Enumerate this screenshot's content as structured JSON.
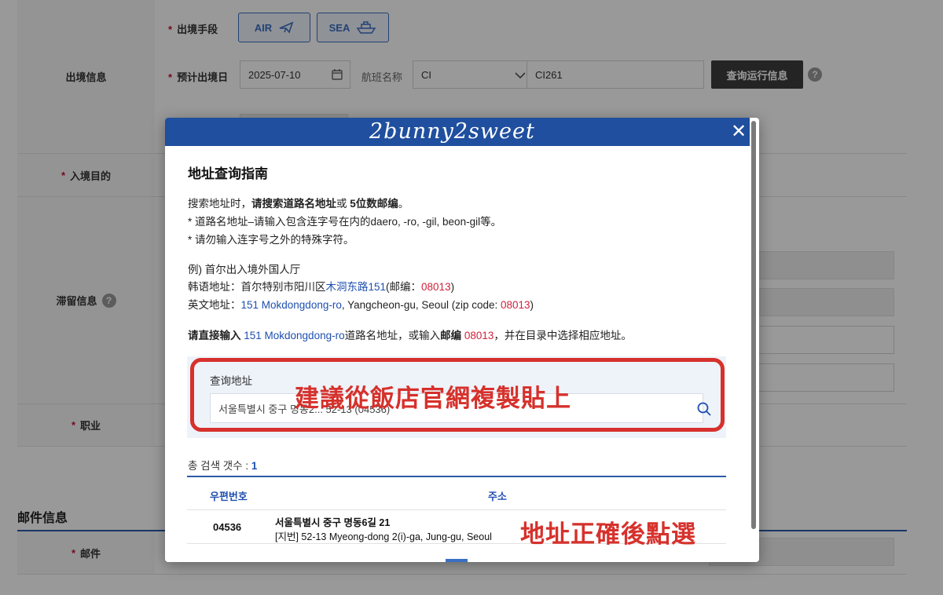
{
  "form": {
    "exit_info_label": "出境信息",
    "transport_label": "出境手段",
    "air_label": "AIR",
    "sea_label": "SEA",
    "exit_date_label": "预计出境日",
    "exit_date_value": "2025-07-10",
    "flight_label": "航班名称",
    "airline_value": "CI",
    "flight_no_value": "CI261",
    "query_button": "查询运行信息",
    "entry_purpose_label": "入境目的",
    "stay_info_label": "滞留信息",
    "occupation_label": "职业",
    "mail_section_title": "邮件信息",
    "mail_label": "邮件",
    "help_glyph": "?"
  },
  "modal": {
    "watermark": "2bunny2sweet",
    "title": "地址查询指南",
    "guide": {
      "line1_a": "搜索地址时，",
      "line1_b": "请搜索道路名地址",
      "line1_c": "或 ",
      "line1_d": "5位数邮编",
      "line1_e": "。",
      "line2": "* 道路名地址–请输入包含连字号在内的daero, -ro, -gil, beon-gil等。",
      "line3": "* 请勿输入连字号之外的特殊字符。"
    },
    "example": {
      "heading": "例) 首尔出入境外国人厅",
      "kr_a": "韩语地址：首尔特别市阳川区",
      "kr_road": "木洞东路151",
      "kr_b": "(邮编：",
      "kr_zip": "08013",
      "kr_c": ")",
      "en_a": "英文地址：",
      "en_road": "151 Mokdongdong-ro",
      "en_b": ", Yangcheon-gu, Seoul (zip code: ",
      "en_zip": "08013",
      "en_c": ")"
    },
    "instruction": {
      "a": "请直接输入",
      "road": " 151 Mokdongdong-ro",
      "b": "道路名地址，或输入",
      "c": "邮编",
      "zip": " 08013",
      "d": "，并在目录中选择相应地址。"
    },
    "search": {
      "label": "查询地址",
      "value": "서울특별시 중구 명동2... 52-13 (04536)"
    },
    "result_count_label": "총 검색 갯수 : ",
    "result_count_value": "1",
    "table": {
      "headers": [
        "우편번호",
        "주소"
      ],
      "rows": [
        {
          "zip": "04536",
          "road_address": "서울특별시 중구 명동6길 21",
          "jibun_address": "[지번] 52-13 Myeong-dong 2(i)-ga, Jung-gu, Seoul"
        }
      ]
    }
  },
  "annotations": {
    "copy_tip": "建議從飯店官網複製貼上",
    "select_tip": "地址正確後點選",
    "color": "#d6312c"
  },
  "colors": {
    "header_blue": "#1f4f9e",
    "link_blue": "#1f4fb0",
    "zip_red": "#d0223b"
  }
}
